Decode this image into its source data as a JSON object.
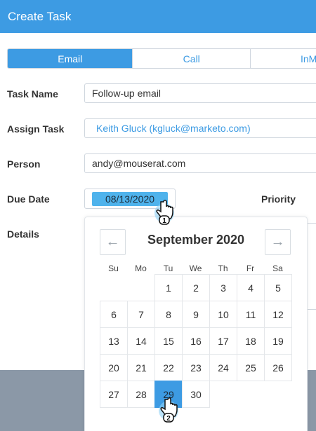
{
  "title": "Create Task",
  "tabs": [
    {
      "label": "Email",
      "active": true
    },
    {
      "label": "Call",
      "active": false
    },
    {
      "label": "InM",
      "active": false
    }
  ],
  "form": {
    "task_name_label": "Task Name",
    "task_name_value": "Follow-up email",
    "assign_label": "Assign Task",
    "assign_value": "Keith Gluck (kgluck@marketo.com)",
    "person_label": "Person",
    "person_value": "andy@mouserat.com",
    "due_label": "Due Date",
    "due_value": "08/13/2020",
    "priority_label": "Priority",
    "details_label": "Details"
  },
  "calendar": {
    "month": "September 2020",
    "prev_glyph": "←",
    "next_glyph": "→",
    "weekdays": [
      "Su",
      "Mo",
      "Tu",
      "We",
      "Th",
      "Fr",
      "Sa"
    ],
    "first_weekday_index": 2,
    "days": [
      "1",
      "2",
      "3",
      "4",
      "5",
      "6",
      "7",
      "8",
      "9",
      "10",
      "11",
      "12",
      "13",
      "14",
      "15",
      "16",
      "17",
      "18",
      "19",
      "20",
      "21",
      "22",
      "23",
      "24",
      "25",
      "26",
      "27",
      "28",
      "29",
      "30"
    ],
    "selected": "29"
  },
  "cursors": [
    {
      "step": "1"
    },
    {
      "step": "2"
    }
  ],
  "colors": {
    "accent": "#3d9be3",
    "date_highlight": "#4fb3ec",
    "backdrop": "#8b98a7"
  }
}
